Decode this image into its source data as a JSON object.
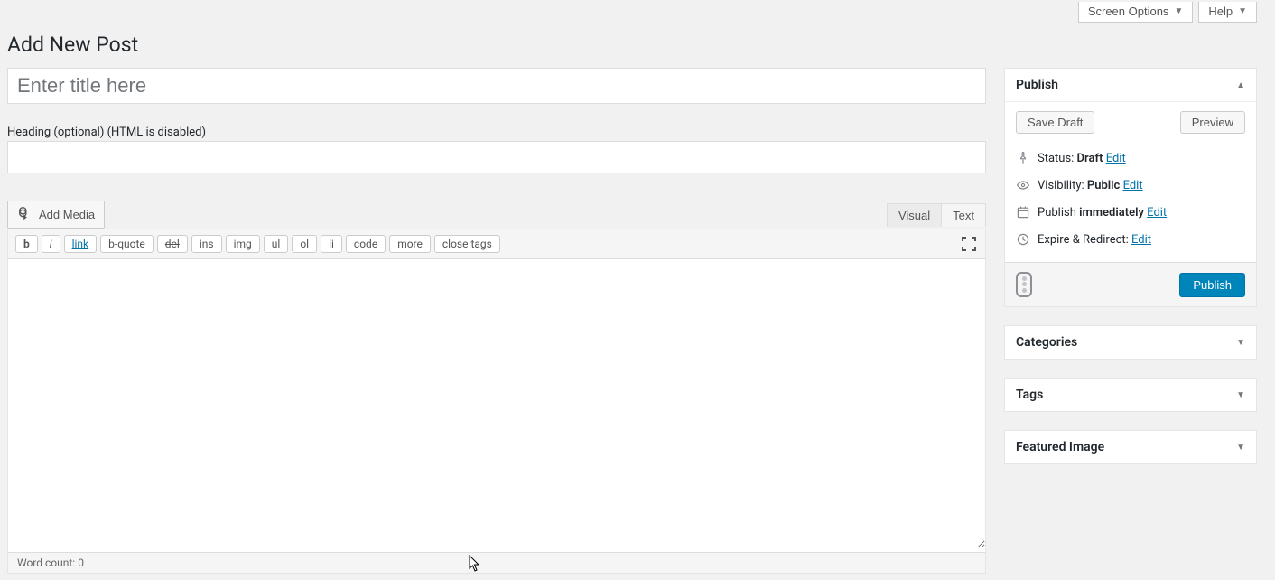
{
  "header": {
    "screen_options": "Screen Options",
    "help": "Help"
  },
  "page_title": "Add New Post",
  "title_placeholder": "Enter title here",
  "heading_label": "Heading (optional) (HTML is disabled)",
  "add_media": "Add Media",
  "editor_tabs": {
    "visual": "Visual",
    "text": "Text"
  },
  "quicktags": {
    "b": "b",
    "i": "i",
    "link": "link",
    "bquote": "b-quote",
    "del": "del",
    "ins": "ins",
    "img": "img",
    "ul": "ul",
    "ol": "ol",
    "li": "li",
    "code": "code",
    "more": "more",
    "close": "close tags"
  },
  "word_count": {
    "label": "Word count: ",
    "value": "0"
  },
  "publish": {
    "title": "Publish",
    "save_draft": "Save Draft",
    "preview": "Preview",
    "status_label": "Status: ",
    "status_value": "Draft",
    "visibility_label": "Visibility: ",
    "visibility_value": "Public",
    "publish_label": "Publish ",
    "publish_value": "immediately",
    "expire_label": "Expire & Redirect: ",
    "edit": "Edit",
    "publish_btn": "Publish"
  },
  "categories_title": "Categories",
  "tags_title": "Tags",
  "featured_title": "Featured Image"
}
